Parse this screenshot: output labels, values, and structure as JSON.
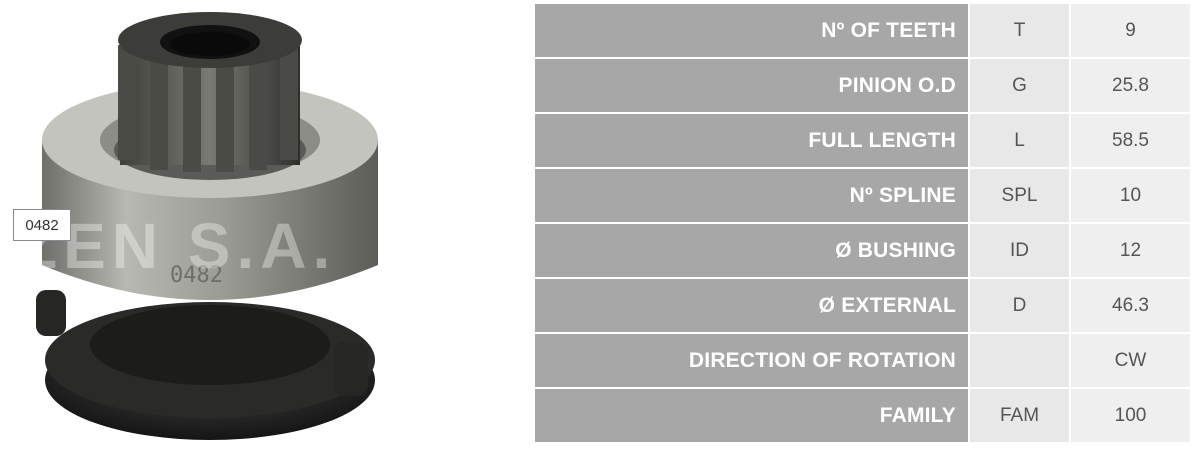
{
  "product": {
    "code_label": "0482",
    "part_stamp": "0482",
    "watermark": "ZEN S.A."
  },
  "specs": [
    {
      "label": "Nº OF TEETH",
      "code": "T",
      "value": "9"
    },
    {
      "label": "PINION O.D",
      "code": "G",
      "value": "25.8"
    },
    {
      "label": "FULL LENGTH",
      "code": "L",
      "value": "58.5"
    },
    {
      "label": "Nº SPLINE",
      "code": "SPL",
      "value": "10"
    },
    {
      "label": "Ø BUSHING",
      "code": "ID",
      "value": "12"
    },
    {
      "label": "Ø EXTERNAL",
      "code": "D",
      "value": "46.3"
    },
    {
      "label": "DIRECTION OF ROTATION",
      "code": "",
      "value": "CW"
    },
    {
      "label": "FAMILY",
      "code": "FAM",
      "value": "100"
    }
  ],
  "colors": {
    "label_bg": "#a7a7a7",
    "code_bg": "#e8e8e8",
    "value_bg": "#efefef"
  }
}
